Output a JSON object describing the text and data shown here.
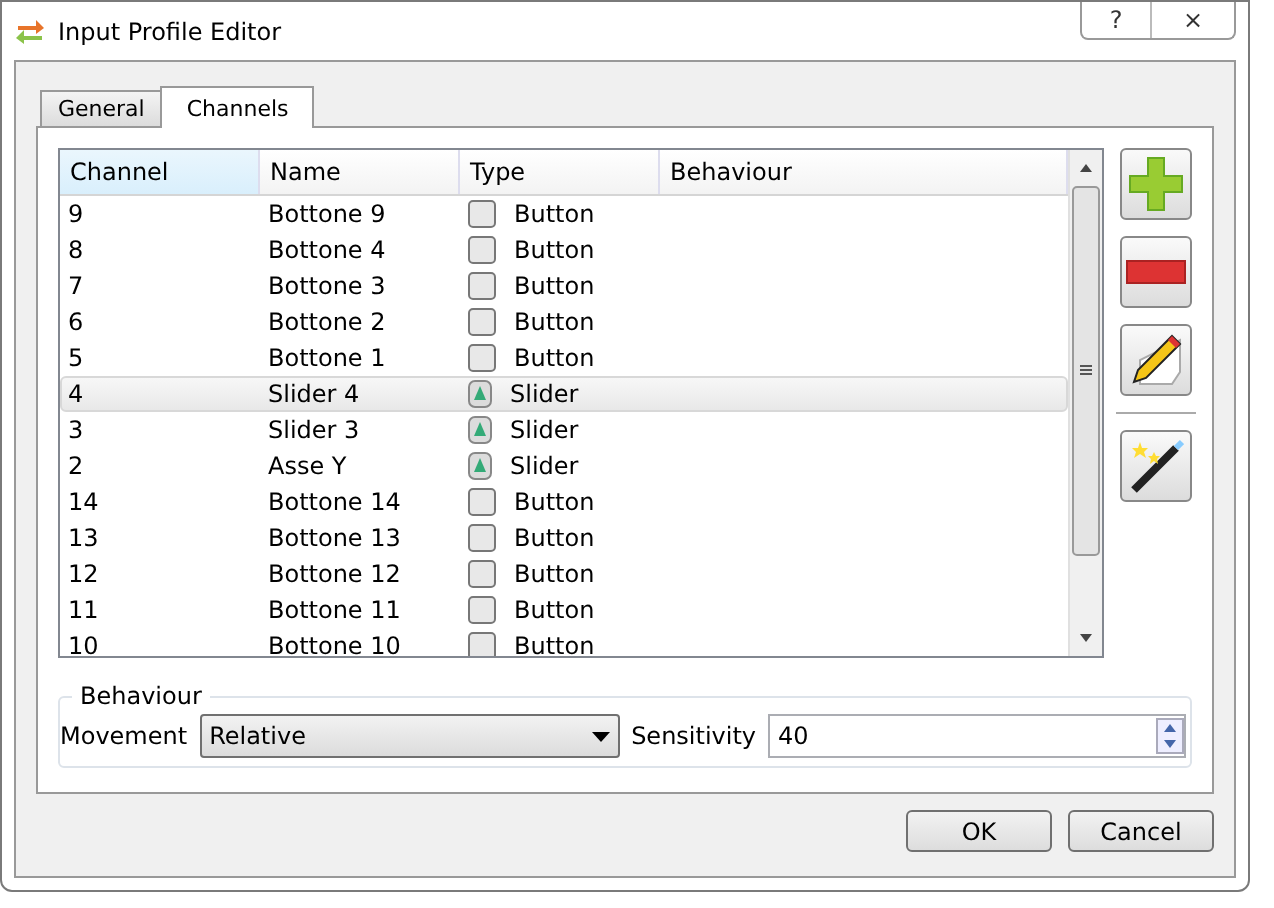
{
  "window": {
    "title": "Input Profile Editor",
    "help": "?",
    "close": "×"
  },
  "tabs": [
    {
      "label": "General",
      "selected": false
    },
    {
      "label": "Channels",
      "selected": true
    }
  ],
  "table": {
    "columns": [
      "Channel",
      "Name",
      "Type",
      "Behaviour"
    ],
    "rows": [
      {
        "channel": "9",
        "name": "Bottone 9",
        "type": "Button",
        "kind": "button",
        "selected": false
      },
      {
        "channel": "8",
        "name": "Bottone 4",
        "type": "Button",
        "kind": "button",
        "selected": false
      },
      {
        "channel": "7",
        "name": "Bottone 3",
        "type": "Button",
        "kind": "button",
        "selected": false
      },
      {
        "channel": "6",
        "name": "Bottone 2",
        "type": "Button",
        "kind": "button",
        "selected": false
      },
      {
        "channel": "5",
        "name": "Bottone 1",
        "type": "Button",
        "kind": "button",
        "selected": false
      },
      {
        "channel": "4",
        "name": "Slider 4",
        "type": "Slider",
        "kind": "slider",
        "selected": true
      },
      {
        "channel": "3",
        "name": "Slider 3",
        "type": "Slider",
        "kind": "slider",
        "selected": false
      },
      {
        "channel": "2",
        "name": "Asse Y",
        "type": "Slider",
        "kind": "slider",
        "selected": false
      },
      {
        "channel": "14",
        "name": "Bottone 14",
        "type": "Button",
        "kind": "button",
        "selected": false
      },
      {
        "channel": "13",
        "name": "Bottone 13",
        "type": "Button",
        "kind": "button",
        "selected": false
      },
      {
        "channel": "12",
        "name": "Bottone 12",
        "type": "Button",
        "kind": "button",
        "selected": false
      },
      {
        "channel": "11",
        "name": "Bottone 11",
        "type": "Button",
        "kind": "button",
        "selected": false
      },
      {
        "channel": "10",
        "name": "Bottone 10",
        "type": "Button",
        "kind": "button",
        "selected": false
      }
    ]
  },
  "behaviour": {
    "title": "Behaviour",
    "movement_label": "Movement",
    "movement": "Relative",
    "sensitivity_label": "Sensitivity",
    "sensitivity": "40"
  },
  "buttons": [
    "OK",
    "Cancel"
  ]
}
